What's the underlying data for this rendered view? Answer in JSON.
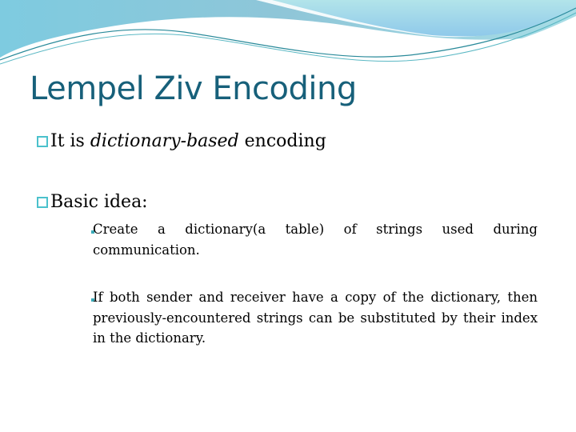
{
  "slide": {
    "title": "Lempel Ziv Encoding",
    "bullets": [
      {
        "prefix": "It is ",
        "emphasis": "dictionary-based",
        "suffix": " encoding"
      },
      {
        "text": "Basic idea:"
      }
    ],
    "sub_bullets": [
      "Create a dictionary(a table) of strings used during communication.",
      "If both sender and receiver have a copy of the dictionary, then previously-encountered strings can be substituted by their index in the dictionary."
    ],
    "colors": {
      "title": "#17607a",
      "bullet_box": "#4bc1cc",
      "wave_light": "#9fdce6",
      "wave_dark": "#5ab3c9"
    }
  }
}
